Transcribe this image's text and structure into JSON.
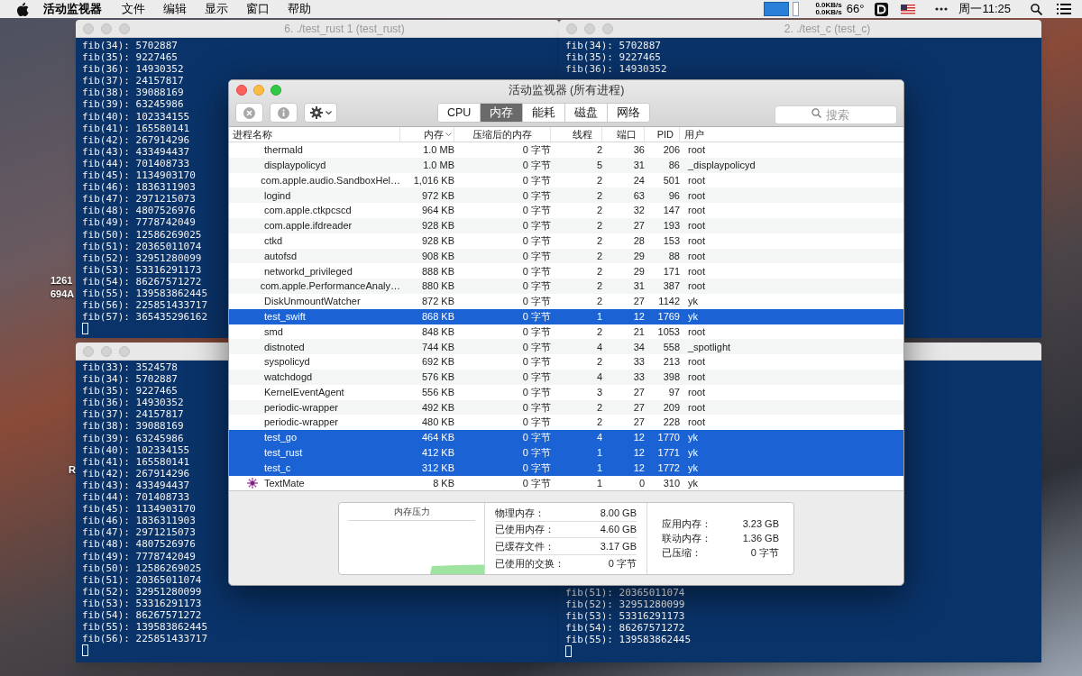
{
  "menu_bar": {
    "app": "活动监视器",
    "menus": [
      "文件",
      "编辑",
      "显示",
      "窗口",
      "帮助"
    ],
    "net_up": "0.0KB/s",
    "net_down": "0.0KB/s",
    "temperature": "66°",
    "clock": "周一11:25"
  },
  "desktop_labels": [
    "1261",
    "694A",
    "R"
  ],
  "terminals": [
    {
      "title": "6. ./test_rust 1 (test_rust)",
      "cursor": true,
      "lines": [
        "fib(34): 5702887",
        "fib(35): 9227465",
        "fib(36): 14930352",
        "fib(37): 24157817",
        "fib(38): 39088169",
        "fib(39): 63245986",
        "fib(40): 102334155",
        "fib(41): 165580141",
        "fib(42): 267914296",
        "fib(43): 433494437",
        "fib(44): 701408733",
        "fib(45): 1134903170",
        "fib(46): 1836311903",
        "fib(47): 2971215073",
        "fib(48): 4807526976",
        "fib(49): 7778742049",
        "fib(50): 12586269025",
        "fib(51): 20365011074",
        "fib(52): 32951280099",
        "fib(53): 53316291173",
        "fib(54): 86267571272",
        "fib(55): 139583862445",
        "fib(56): 225851433717",
        "fib(57): 365435296162"
      ]
    },
    {
      "title": "2. ./test_c (test_c)",
      "cursor": false,
      "lines": [
        "fib(34): 5702887",
        "fib(35): 9227465",
        "fib(36): 14930352"
      ]
    },
    {
      "cursor": true,
      "lines": [
        "fib(33): 3524578",
        "fib(34): 5702887",
        "fib(35): 9227465",
        "fib(36): 14930352",
        "fib(37): 24157817",
        "fib(38): 39088169",
        "fib(39): 63245986",
        "fib(40): 102334155",
        "fib(41): 165580141",
        "fib(42): 267914296",
        "fib(43): 433494437",
        "fib(44): 701408733",
        "fib(45): 1134903170",
        "fib(46): 1836311903",
        "fib(47): 2971215073",
        "fib(48): 4807526976",
        "fib(49): 7778742049",
        "fib(50): 12586269025",
        "fib(51): 20365011074",
        "fib(52): 32951280099",
        "fib(53): 53316291173",
        "fib(54): 86267571272",
        "fib(55): 139583862445",
        "fib(56): 225851433717"
      ]
    },
    {
      "cursor": true,
      "lines": [
        "fib(51): 20365011074",
        "fib(52): 32951280099",
        "fib(53): 53316291173",
        "fib(54): 86267571272",
        "fib(55): 139583862445"
      ]
    }
  ],
  "activity_monitor": {
    "title": "活动监视器 (所有进程)",
    "tabs": [
      {
        "label": "CPU",
        "selected": false
      },
      {
        "label": "内存",
        "selected": true
      },
      {
        "label": "能耗",
        "selected": false
      },
      {
        "label": "磁盘",
        "selected": false
      },
      {
        "label": "网络",
        "selected": false
      }
    ],
    "search": {
      "placeholder": "搜索"
    },
    "table": {
      "columns": [
        "进程名称",
        "内存",
        "压缩后的内存",
        "线程",
        "端口",
        "PID",
        "用户"
      ],
      "rows": [
        {
          "cells": [
            "thermald",
            "1.0 MB",
            "0 字节",
            "2",
            "36",
            "206",
            "root"
          ],
          "selected": false,
          "has_icon": false
        },
        {
          "cells": [
            "displaypolicyd",
            "1.0 MB",
            "0 字节",
            "5",
            "31",
            "86",
            "_displaypolicyd"
          ],
          "selected": false,
          "has_icon": false
        },
        {
          "cells": [
            "com.apple.audio.SandboxHel…",
            "1,016 KB",
            "0 字节",
            "2",
            "24",
            "501",
            "root"
          ],
          "selected": false,
          "has_icon": false
        },
        {
          "cells": [
            "logind",
            "972 KB",
            "0 字节",
            "2",
            "63",
            "96",
            "root"
          ],
          "selected": false,
          "has_icon": false
        },
        {
          "cells": [
            "com.apple.ctkpcscd",
            "964 KB",
            "0 字节",
            "2",
            "32",
            "147",
            "root"
          ],
          "selected": false,
          "has_icon": false
        },
        {
          "cells": [
            "com.apple.ifdreader",
            "928 KB",
            "0 字节",
            "2",
            "27",
            "193",
            "root"
          ],
          "selected": false,
          "has_icon": false
        },
        {
          "cells": [
            "ctkd",
            "928 KB",
            "0 字节",
            "2",
            "28",
            "153",
            "root"
          ],
          "selected": false,
          "has_icon": false
        },
        {
          "cells": [
            "autofsd",
            "908 KB",
            "0 字节",
            "2",
            "29",
            "88",
            "root"
          ],
          "selected": false,
          "has_icon": false
        },
        {
          "cells": [
            "networkd_privileged",
            "888 KB",
            "0 字节",
            "2",
            "29",
            "171",
            "root"
          ],
          "selected": false,
          "has_icon": false
        },
        {
          "cells": [
            "com.apple.PerformanceAnaly…",
            "880 KB",
            "0 字节",
            "2",
            "31",
            "387",
            "root"
          ],
          "selected": false,
          "has_icon": false
        },
        {
          "cells": [
            "DiskUnmountWatcher",
            "872 KB",
            "0 字节",
            "2",
            "27",
            "1142",
            "yk"
          ],
          "selected": false,
          "has_icon": false
        },
        {
          "cells": [
            "test_swift",
            "868 KB",
            "0 字节",
            "1",
            "12",
            "1769",
            "yk"
          ],
          "selected": true,
          "has_icon": false
        },
        {
          "cells": [
            "smd",
            "848 KB",
            "0 字节",
            "2",
            "21",
            "1053",
            "root"
          ],
          "selected": false,
          "has_icon": false
        },
        {
          "cells": [
            "distnoted",
            "744 KB",
            "0 字节",
            "4",
            "34",
            "558",
            "_spotlight"
          ],
          "selected": false,
          "has_icon": false
        },
        {
          "cells": [
            "syspolicyd",
            "692 KB",
            "0 字节",
            "2",
            "33",
            "213",
            "root"
          ],
          "selected": false,
          "has_icon": false
        },
        {
          "cells": [
            "watchdogd",
            "576 KB",
            "0 字节",
            "4",
            "33",
            "398",
            "root"
          ],
          "selected": false,
          "has_icon": false
        },
        {
          "cells": [
            "KernelEventAgent",
            "556 KB",
            "0 字节",
            "3",
            "27",
            "97",
            "root"
          ],
          "selected": false,
          "has_icon": false
        },
        {
          "cells": [
            "periodic-wrapper",
            "492 KB",
            "0 字节",
            "2",
            "27",
            "209",
            "root"
          ],
          "selected": false,
          "has_icon": false
        },
        {
          "cells": [
            "periodic-wrapper",
            "480 KB",
            "0 字节",
            "2",
            "27",
            "228",
            "root"
          ],
          "selected": false,
          "has_icon": false
        },
        {
          "cells": [
            "test_go",
            "464 KB",
            "0 字节",
            "4",
            "12",
            "1770",
            "yk"
          ],
          "selected": true,
          "has_icon": false
        },
        {
          "cells": [
            "test_rust",
            "412 KB",
            "0 字节",
            "1",
            "12",
            "1771",
            "yk"
          ],
          "selected": true,
          "has_icon": false
        },
        {
          "cells": [
            "test_c",
            "312 KB",
            "0 字节",
            "1",
            "12",
            "1772",
            "yk"
          ],
          "selected": true,
          "has_icon": false
        },
        {
          "cells": [
            "TextMate",
            "8 KB",
            "0 字节",
            "1",
            "0",
            "310",
            "yk"
          ],
          "selected": false,
          "has_icon": true
        }
      ]
    },
    "memory": {
      "pressure_label": "内存压力",
      "details": [
        {
          "label": "物理内存：",
          "value": "8.00 GB"
        },
        {
          "label": "已使用内存：",
          "value": "4.60 GB"
        },
        {
          "label": "已缓存文件：",
          "value": "3.17 GB"
        },
        {
          "label": "已使用的交换：",
          "value": "0 字节"
        }
      ],
      "breakdown": [
        {
          "label": "应用内存：",
          "value": "3.23 GB"
        },
        {
          "label": "联动内存：",
          "value": "1.36 GB"
        },
        {
          "label": "已压缩：",
          "value": "0 字节"
        }
      ]
    }
  }
}
